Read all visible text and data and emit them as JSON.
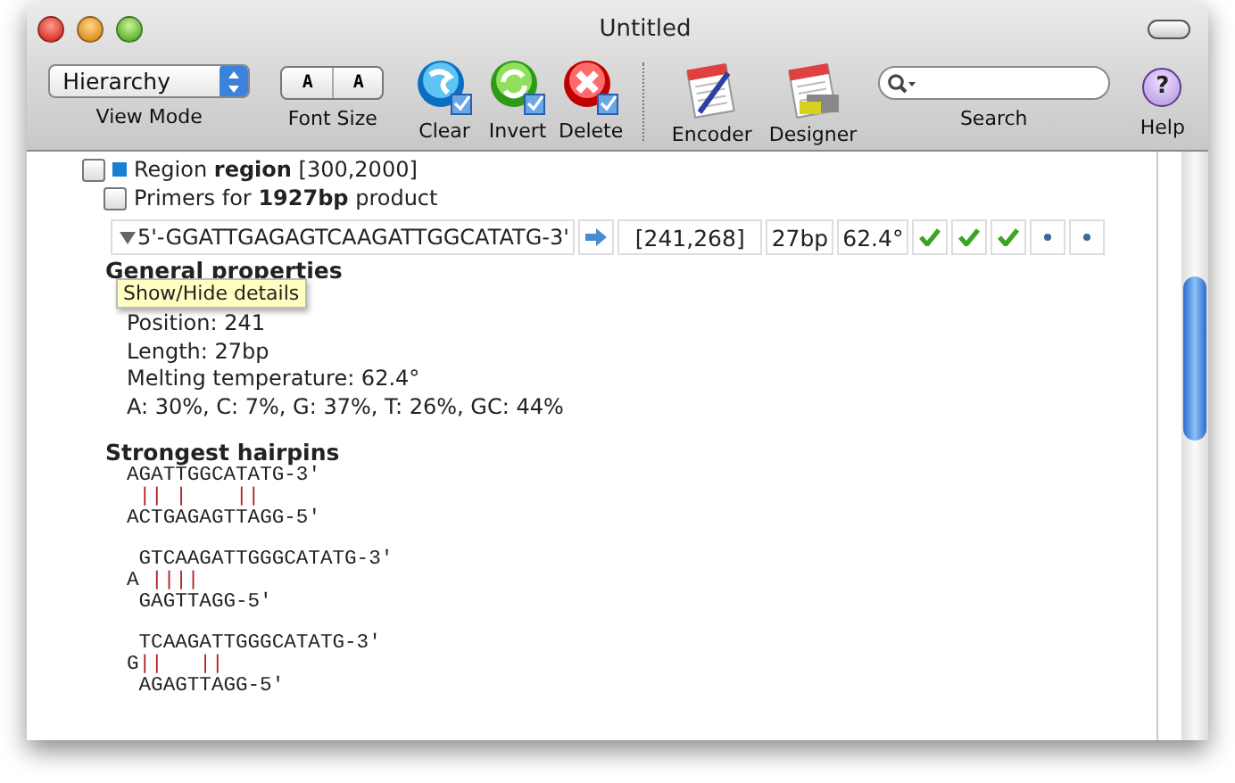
{
  "window": {
    "title": "Untitled"
  },
  "toolbar": {
    "view_mode": {
      "value": "Hierarchy",
      "label": "View Mode"
    },
    "font_size": {
      "segments": [
        "A",
        "A"
      ],
      "label": "Font Size"
    },
    "actions": [
      {
        "kind": "clear",
        "label": "Clear"
      },
      {
        "kind": "invert",
        "label": "Invert"
      },
      {
        "kind": "delete",
        "label": "Delete"
      }
    ],
    "tools": [
      {
        "kind": "encoder",
        "label": "Encoder"
      },
      {
        "kind": "designer",
        "label": "Designer"
      }
    ],
    "search": {
      "label": "Search"
    },
    "help": {
      "glyph": "?",
      "label": "Help"
    }
  },
  "region": {
    "checked": false,
    "text": "Region **region** [300,2000]"
  },
  "primer_group": {
    "checked": false,
    "text": "Primers for **1927bp** product"
  },
  "primer": {
    "expanded": true,
    "sequence": "5'-GGATTGAGAGTCAAGATTGGCATATG-3'",
    "range": "[241,268]",
    "length": "27bp",
    "tm": "62.4°",
    "checks": [
      {
        "passed": true
      },
      {
        "passed": true
      },
      {
        "passed": true
      },
      {
        "passed": false
      },
      {
        "passed": false
      }
    ]
  },
  "tooltip": "Show/Hide details",
  "details": {
    "heading": "General properties",
    "lines": [
      "Position: 241",
      "Length: 27bp",
      "Melting temperature: 62.4°",
      "A: 30%, C: 7%, G: 37%, T: 26%, GC: 44%"
    ],
    "hairpins_heading": "Strongest hairpins",
    "hairpins": [
      {
        "top": "AGATTGGCATATG-3'",
        "bonds": " || |    ||",
        "bottom": "ACTGAGAGTTAGG-5'"
      },
      {
        "top": "GTCAAGATTGGGCATATG-3'",
        "loop": "A",
        "bonds": " ||||",
        "bottom": "GAGTTAGG-5'"
      },
      {
        "top": "TCAAGATTGGGCATATG-3'",
        "loop": "G",
        "bonds": "||   ||",
        "bottom": "AGAGTTAGG-5'"
      }
    ]
  }
}
